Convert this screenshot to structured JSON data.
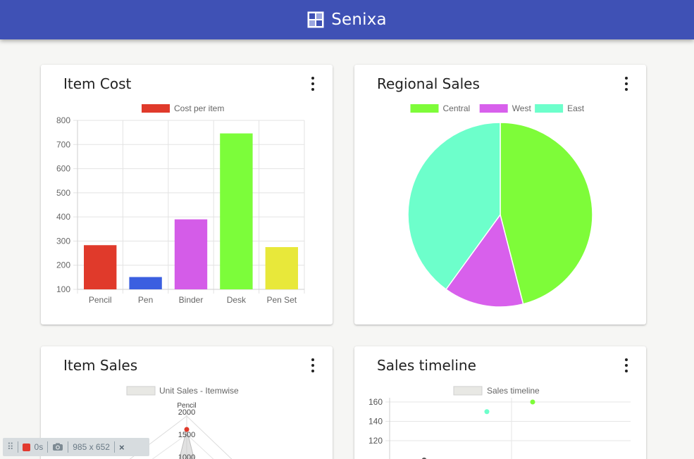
{
  "app": {
    "title": "Senixa"
  },
  "colors": {
    "header": "#3f51b5",
    "card": "#ffffff",
    "background": "#f6f6f4"
  },
  "cards": [
    {
      "title": "Item Cost"
    },
    {
      "title": "Regional Sales"
    },
    {
      "title": "Item Sales"
    },
    {
      "title": "Sales timeline"
    }
  ],
  "chart_data": [
    {
      "type": "bar",
      "title": "Item Cost",
      "legend": [
        "Cost per item"
      ],
      "legend_color": "#e03a2b",
      "categories": [
        "Pencil",
        "Pen",
        "Binder",
        "Desk",
        "Pen Set"
      ],
      "values": [
        283,
        151,
        390,
        746,
        275
      ],
      "colors": [
        "#e03a2b",
        "#3b5fe0",
        "#d45ce8",
        "#7cfd3a",
        "#e8e83a"
      ],
      "ylim": [
        100,
        800
      ],
      "yticks": [
        100,
        200,
        300,
        400,
        500,
        600,
        700,
        800
      ],
      "grid": true,
      "legend_position": "top"
    },
    {
      "type": "pie",
      "title": "Regional Sales",
      "labels": [
        "Central",
        "West",
        "East"
      ],
      "values": [
        46,
        14,
        40
      ],
      "colors": [
        "#7efc39",
        "#d860ec",
        "#6dffcb"
      ],
      "legend_position": "top"
    },
    {
      "type": "radar",
      "title": "Item Sales",
      "legend": [
        "Unit Sales - Itemwise"
      ],
      "axis_labels": [
        "Pencil"
      ],
      "ticks": [
        2000,
        1500,
        1000
      ],
      "values": [
        1500
      ],
      "legend_position": "top"
    },
    {
      "type": "scatter",
      "title": "Sales timeline",
      "legend": [
        "Sales timeline"
      ],
      "yticks": [
        160,
        140,
        120
      ],
      "ylim": [
        100,
        160
      ],
      "points": [
        {
          "y": 150,
          "color": "#6dffcb"
        },
        {
          "y": 160,
          "color": "#7efc39"
        },
        {
          "y": 100,
          "color": "#555555"
        }
      ],
      "legend_position": "top"
    }
  ],
  "toolbar": {
    "elapsed": "0s",
    "dimensions": "985 x 652",
    "close": "×"
  }
}
